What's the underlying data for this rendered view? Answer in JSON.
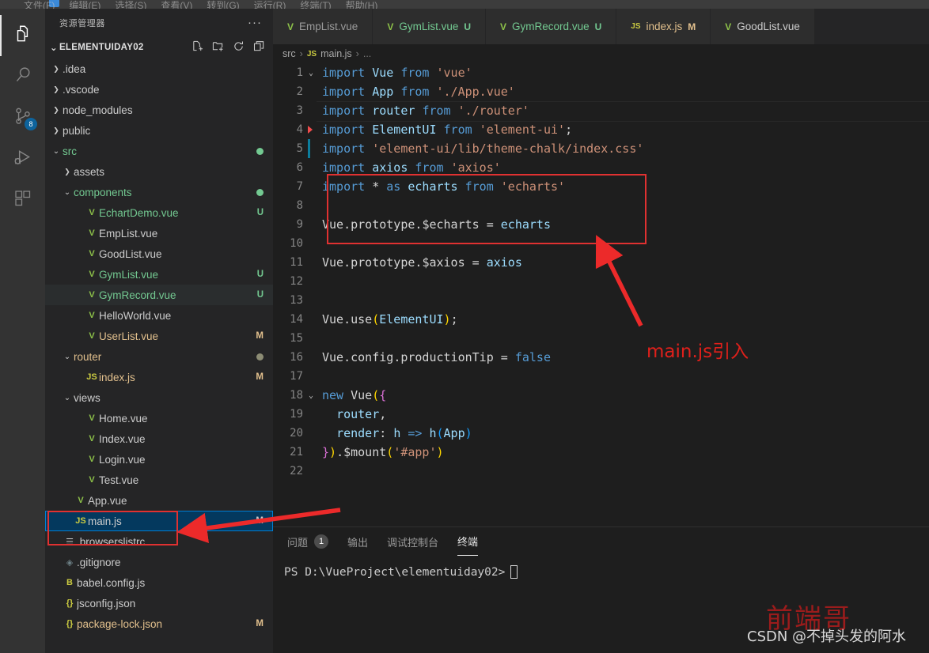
{
  "window": {
    "menu_items": [
      "文件(F)",
      "编辑(E)",
      "选择(S)",
      "查看(V)",
      "转到(G)",
      "运行(R)",
      "终端(T)",
      "帮助(H)"
    ]
  },
  "activity_bar": {
    "items": [
      {
        "name": "explorer",
        "icon": "files-icon",
        "active": true,
        "badge": ""
      },
      {
        "name": "search",
        "icon": "search-icon",
        "active": false,
        "badge": ""
      },
      {
        "name": "source-control",
        "icon": "source-control-icon",
        "active": false,
        "badge": "8"
      },
      {
        "name": "run-debug",
        "icon": "run-debug-icon",
        "active": false,
        "badge": ""
      },
      {
        "name": "extensions",
        "icon": "extensions-icon",
        "active": false,
        "badge": ""
      }
    ]
  },
  "sidebar": {
    "title": "资源管理器",
    "more_actions": "···",
    "root_label": "ELEMENTUIDAY02",
    "root_actions": [
      "new-file-icon",
      "new-folder-icon",
      "refresh-icon",
      "collapse-all-icon"
    ],
    "tree": [
      {
        "label": ".idea",
        "indent": 1,
        "chev": "›",
        "icon": "",
        "icon_cls": "",
        "color": "c-plain",
        "badge": "",
        "dot": "",
        "state": ""
      },
      {
        "label": ".vscode",
        "indent": 1,
        "chev": "›",
        "icon": "",
        "icon_cls": "",
        "color": "c-plain",
        "badge": "",
        "dot": "",
        "state": ""
      },
      {
        "label": "node_modules",
        "indent": 1,
        "chev": "›",
        "icon": "",
        "icon_cls": "",
        "color": "c-plain",
        "badge": "",
        "dot": "",
        "state": ""
      },
      {
        "label": "public",
        "indent": 1,
        "chev": "›",
        "icon": "",
        "icon_cls": "",
        "color": "c-plain",
        "badge": "",
        "dot": "",
        "state": ""
      },
      {
        "label": "src",
        "indent": 1,
        "chev": "⌄",
        "icon": "",
        "icon_cls": "",
        "color": "c-green",
        "badge": "",
        "dot": "d-green",
        "state": ""
      },
      {
        "label": "assets",
        "indent": 2,
        "chev": "›",
        "icon": "",
        "icon_cls": "",
        "color": "c-plain",
        "badge": "",
        "dot": "",
        "state": ""
      },
      {
        "label": "components",
        "indent": 2,
        "chev": "⌄",
        "icon": "",
        "icon_cls": "",
        "color": "c-green",
        "badge": "",
        "dot": "d-green",
        "state": ""
      },
      {
        "label": "EchartDemo.vue",
        "indent": 3,
        "chev": "",
        "icon": "V",
        "icon_cls": "vue-ico",
        "color": "c-green",
        "badge": "U",
        "dot": "",
        "state": ""
      },
      {
        "label": "EmpList.vue",
        "indent": 3,
        "chev": "",
        "icon": "V",
        "icon_cls": "vue-ico",
        "color": "c-plain",
        "badge": "",
        "dot": "",
        "state": ""
      },
      {
        "label": "GoodList.vue",
        "indent": 3,
        "chev": "",
        "icon": "V",
        "icon_cls": "vue-ico",
        "color": "c-plain",
        "badge": "",
        "dot": "",
        "state": ""
      },
      {
        "label": "GymList.vue",
        "indent": 3,
        "chev": "",
        "icon": "V",
        "icon_cls": "vue-ico",
        "color": "c-green",
        "badge": "U",
        "dot": "",
        "state": ""
      },
      {
        "label": "GymRecord.vue",
        "indent": 3,
        "chev": "",
        "icon": "V",
        "icon_cls": "vue-ico",
        "color": "c-green",
        "badge": "U",
        "dot": "",
        "state": "highlight"
      },
      {
        "label": "HelloWorld.vue",
        "indent": 3,
        "chev": "",
        "icon": "V",
        "icon_cls": "vue-ico",
        "color": "c-plain",
        "badge": "",
        "dot": "",
        "state": ""
      },
      {
        "label": "UserList.vue",
        "indent": 3,
        "chev": "",
        "icon": "V",
        "icon_cls": "vue-ico",
        "color": "c-mod",
        "badge": "M",
        "dot": "",
        "state": ""
      },
      {
        "label": "router",
        "indent": 2,
        "chev": "⌄",
        "icon": "",
        "icon_cls": "",
        "color": "c-mod",
        "badge": "",
        "dot": "d-grey",
        "state": ""
      },
      {
        "label": "index.js",
        "indent": 3,
        "chev": "",
        "icon": "JS",
        "icon_cls": "js-ico",
        "color": "c-mod",
        "badge": "M",
        "dot": "",
        "state": ""
      },
      {
        "label": "views",
        "indent": 2,
        "chev": "⌄",
        "icon": "",
        "icon_cls": "",
        "color": "c-plain",
        "badge": "",
        "dot": "",
        "state": ""
      },
      {
        "label": "Home.vue",
        "indent": 3,
        "chev": "",
        "icon": "V",
        "icon_cls": "vue-ico",
        "color": "c-plain",
        "badge": "",
        "dot": "",
        "state": ""
      },
      {
        "label": "Index.vue",
        "indent": 3,
        "chev": "",
        "icon": "V",
        "icon_cls": "vue-ico",
        "color": "c-plain",
        "badge": "",
        "dot": "",
        "state": ""
      },
      {
        "label": "Login.vue",
        "indent": 3,
        "chev": "",
        "icon": "V",
        "icon_cls": "vue-ico",
        "color": "c-plain",
        "badge": "",
        "dot": "",
        "state": ""
      },
      {
        "label": "Test.vue",
        "indent": 3,
        "chev": "",
        "icon": "V",
        "icon_cls": "vue-ico",
        "color": "c-plain",
        "badge": "",
        "dot": "",
        "state": ""
      },
      {
        "label": "App.vue",
        "indent": 2,
        "chev": "",
        "icon": "V",
        "icon_cls": "vue-ico",
        "color": "c-plain",
        "badge": "",
        "dot": "",
        "state": ""
      },
      {
        "label": "main.js",
        "indent": 2,
        "chev": "",
        "icon": "JS",
        "icon_cls": "js-ico",
        "color": "c-plain",
        "badge": "M",
        "dot": "",
        "state": "selected"
      },
      {
        "label": ".browserslistrc",
        "indent": 1,
        "chev": "",
        "icon": "☰",
        "icon_cls": "list-ico",
        "color": "c-plain",
        "badge": "",
        "dot": "",
        "state": ""
      },
      {
        "label": ".gitignore",
        "indent": 1,
        "chev": "",
        "icon": "◈",
        "icon_cls": "git-ico",
        "color": "c-plain",
        "badge": "",
        "dot": "",
        "state": ""
      },
      {
        "label": "babel.config.js",
        "indent": 1,
        "chev": "",
        "icon": "B",
        "icon_cls": "cfg-ico",
        "color": "c-plain",
        "badge": "",
        "dot": "",
        "state": ""
      },
      {
        "label": "jsconfig.json",
        "indent": 1,
        "chev": "",
        "icon": "{}",
        "icon_cls": "json-ico",
        "color": "c-plain",
        "badge": "",
        "dot": "",
        "state": ""
      },
      {
        "label": "package-lock.json",
        "indent": 1,
        "chev": "",
        "icon": "{}",
        "icon_cls": "json-ico",
        "color": "c-mod",
        "badge": "M",
        "dot": "",
        "state": ""
      }
    ]
  },
  "tabs": [
    {
      "label": "EmpList.vue",
      "icon": "V",
      "icon_cls": "vue-ico",
      "badge": "",
      "badge_color": "#73c991",
      "color": "#9a9a9a",
      "active": false
    },
    {
      "label": "GymList.vue",
      "icon": "V",
      "icon_cls": "vue-ico",
      "badge": "U",
      "badge_color": "#73c991",
      "color": "#73c991",
      "active": false
    },
    {
      "label": "GymRecord.vue",
      "icon": "V",
      "icon_cls": "vue-ico",
      "badge": "U",
      "badge_color": "#73c991",
      "color": "#73c991",
      "active": false
    },
    {
      "label": "index.js",
      "icon": "JS",
      "icon_cls": "js-ico",
      "badge": "M",
      "badge_color": "#e2c08d",
      "color": "#e2c08d",
      "active": false
    },
    {
      "label": "GoodList.vue",
      "icon": "V",
      "icon_cls": "vue-ico",
      "badge": "",
      "badge_color": "#9a9a9a",
      "color": "#cccccc",
      "active": false
    }
  ],
  "breadcrumb": {
    "root": "src",
    "file": "main.js",
    "file_icon": "JS",
    "tail": "..."
  },
  "code": {
    "lines": [
      {
        "n": "1",
        "fold": "⌄",
        "marker": "",
        "cur": false,
        "tokens": [
          {
            "t": "import",
            "c": "k"
          },
          {
            "t": " ",
            "c": "w"
          },
          {
            "t": "Vue",
            "c": "v"
          },
          {
            "t": " ",
            "c": "w"
          },
          {
            "t": "from",
            "c": "k"
          },
          {
            "t": " ",
            "c": "w"
          },
          {
            "t": "'vue'",
            "c": "s"
          }
        ]
      },
      {
        "n": "2",
        "fold": "",
        "marker": "",
        "cur": false,
        "tokens": [
          {
            "t": "import",
            "c": "k"
          },
          {
            "t": " ",
            "c": "w"
          },
          {
            "t": "App",
            "c": "v"
          },
          {
            "t": " ",
            "c": "w"
          },
          {
            "t": "from",
            "c": "k"
          },
          {
            "t": " ",
            "c": "w"
          },
          {
            "t": "'./App.vue'",
            "c": "s"
          }
        ]
      },
      {
        "n": "3",
        "fold": "",
        "marker": "",
        "cur": true,
        "tokens": [
          {
            "t": "import",
            "c": "k"
          },
          {
            "t": " ",
            "c": "w"
          },
          {
            "t": "router",
            "c": "v"
          },
          {
            "t": " ",
            "c": "w"
          },
          {
            "t": "from",
            "c": "k"
          },
          {
            "t": " ",
            "c": "w"
          },
          {
            "t": "'./router'",
            "c": "s"
          }
        ]
      },
      {
        "n": "4",
        "fold": "",
        "marker": "err",
        "cur": false,
        "tokens": [
          {
            "t": "import",
            "c": "k"
          },
          {
            "t": " ",
            "c": "w"
          },
          {
            "t": "ElementUI",
            "c": "v"
          },
          {
            "t": " ",
            "c": "w"
          },
          {
            "t": "from",
            "c": "k"
          },
          {
            "t": " ",
            "c": "w"
          },
          {
            "t": "'element-ui'",
            "c": "s"
          },
          {
            "t": ";",
            "c": "w"
          }
        ]
      },
      {
        "n": "5",
        "fold": "",
        "marker": "mod",
        "cur": false,
        "tokens": [
          {
            "t": "import",
            "c": "k"
          },
          {
            "t": " ",
            "c": "w"
          },
          {
            "t": "'element-ui/lib/theme-chalk/index.css'",
            "c": "s"
          }
        ]
      },
      {
        "n": "6",
        "fold": "",
        "marker": "",
        "cur": false,
        "tokens": [
          {
            "t": "import",
            "c": "k"
          },
          {
            "t": " ",
            "c": "w"
          },
          {
            "t": "axios",
            "c": "v"
          },
          {
            "t": " ",
            "c": "w"
          },
          {
            "t": "from",
            "c": "k"
          },
          {
            "t": " ",
            "c": "w"
          },
          {
            "t": "'axios'",
            "c": "s"
          }
        ]
      },
      {
        "n": "7",
        "fold": "",
        "marker": "",
        "cur": false,
        "tokens": [
          {
            "t": "import",
            "c": "k"
          },
          {
            "t": " ",
            "c": "w"
          },
          {
            "t": "*",
            "c": "w"
          },
          {
            "t": " ",
            "c": "w"
          },
          {
            "t": "as",
            "c": "k"
          },
          {
            "t": " ",
            "c": "w"
          },
          {
            "t": "echarts",
            "c": "v"
          },
          {
            "t": " ",
            "c": "w"
          },
          {
            "t": "from",
            "c": "k"
          },
          {
            "t": " ",
            "c": "w"
          },
          {
            "t": "'echarts'",
            "c": "s"
          }
        ]
      },
      {
        "n": "8",
        "fold": "",
        "marker": "",
        "cur": false,
        "tokens": []
      },
      {
        "n": "9",
        "fold": "",
        "marker": "",
        "cur": false,
        "tokens": [
          {
            "t": "Vue",
            "c": "w"
          },
          {
            "t": ".",
            "c": "w"
          },
          {
            "t": "prototype",
            "c": "w"
          },
          {
            "t": ".",
            "c": "w"
          },
          {
            "t": "$echarts",
            "c": "w"
          },
          {
            "t": " = ",
            "c": "w"
          },
          {
            "t": "echarts",
            "c": "v"
          }
        ]
      },
      {
        "n": "10",
        "fold": "",
        "marker": "",
        "cur": false,
        "tokens": []
      },
      {
        "n": "11",
        "fold": "",
        "marker": "",
        "cur": false,
        "tokens": [
          {
            "t": "Vue",
            "c": "w"
          },
          {
            "t": ".",
            "c": "w"
          },
          {
            "t": "prototype",
            "c": "w"
          },
          {
            "t": ".",
            "c": "w"
          },
          {
            "t": "$axios",
            "c": "w"
          },
          {
            "t": " = ",
            "c": "w"
          },
          {
            "t": "axios",
            "c": "v"
          }
        ]
      },
      {
        "n": "12",
        "fold": "",
        "marker": "",
        "cur": false,
        "tokens": []
      },
      {
        "n": "13",
        "fold": "",
        "marker": "",
        "cur": false,
        "tokens": []
      },
      {
        "n": "14",
        "fold": "",
        "marker": "",
        "cur": false,
        "tokens": [
          {
            "t": "Vue",
            "c": "w"
          },
          {
            "t": ".",
            "c": "w"
          },
          {
            "t": "use",
            "c": "w"
          },
          {
            "t": "(",
            "c": "b1"
          },
          {
            "t": "ElementUI",
            "c": "v"
          },
          {
            "t": ")",
            "c": "b1"
          },
          {
            "t": ";",
            "c": "w"
          }
        ]
      },
      {
        "n": "15",
        "fold": "",
        "marker": "",
        "cur": false,
        "tokens": []
      },
      {
        "n": "16",
        "fold": "",
        "marker": "",
        "cur": false,
        "tokens": [
          {
            "t": "Vue",
            "c": "w"
          },
          {
            "t": ".",
            "c": "w"
          },
          {
            "t": "config",
            "c": "w"
          },
          {
            "t": ".",
            "c": "w"
          },
          {
            "t": "productionTip",
            "c": "w"
          },
          {
            "t": " = ",
            "c": "w"
          },
          {
            "t": "false",
            "c": "k"
          }
        ]
      },
      {
        "n": "17",
        "fold": "",
        "marker": "",
        "cur": false,
        "tokens": []
      },
      {
        "n": "18",
        "fold": "⌄",
        "marker": "",
        "cur": false,
        "tokens": [
          {
            "t": "new",
            "c": "k"
          },
          {
            "t": " ",
            "c": "w"
          },
          {
            "t": "Vue",
            "c": "w"
          },
          {
            "t": "(",
            "c": "b1"
          },
          {
            "t": "{",
            "c": "b2"
          }
        ]
      },
      {
        "n": "19",
        "fold": "",
        "marker": "",
        "cur": false,
        "tokens": [
          {
            "t": "  ",
            "c": "w"
          },
          {
            "t": "router",
            "c": "v"
          },
          {
            "t": ",",
            "c": "w"
          }
        ]
      },
      {
        "n": "20",
        "fold": "",
        "marker": "",
        "cur": false,
        "tokens": [
          {
            "t": "  ",
            "c": "w"
          },
          {
            "t": "render",
            "c": "v"
          },
          {
            "t": ": ",
            "c": "w"
          },
          {
            "t": "h",
            "c": "v"
          },
          {
            "t": " ",
            "c": "w"
          },
          {
            "t": "=>",
            "c": "k"
          },
          {
            "t": " ",
            "c": "w"
          },
          {
            "t": "h",
            "c": "v"
          },
          {
            "t": "(",
            "c": "b3"
          },
          {
            "t": "App",
            "c": "v"
          },
          {
            "t": ")",
            "c": "b3"
          }
        ]
      },
      {
        "n": "21",
        "fold": "",
        "marker": "",
        "cur": false,
        "tokens": [
          {
            "t": "}",
            "c": "b2"
          },
          {
            "t": ")",
            "c": "b1"
          },
          {
            "t": ".",
            "c": "w"
          },
          {
            "t": "$mount",
            "c": "w"
          },
          {
            "t": "(",
            "c": "b1"
          },
          {
            "t": "'#app'",
            "c": "s"
          },
          {
            "t": ")",
            "c": "b1"
          }
        ]
      },
      {
        "n": "22",
        "fold": "",
        "marker": "",
        "cur": false,
        "tokens": []
      }
    ]
  },
  "panel": {
    "tabs": [
      {
        "label": "问题",
        "badge": "1",
        "active": false
      },
      {
        "label": "输出",
        "badge": "",
        "active": false
      },
      {
        "label": "调试控制台",
        "badge": "",
        "active": false
      },
      {
        "label": "终端",
        "badge": "",
        "active": true
      }
    ],
    "terminal_prompt": "PS D:\\VueProject\\elementuiday02>"
  },
  "annotations": {
    "code_note": "main.js引入",
    "accent_color": "#e03131"
  },
  "watermark": {
    "red": "前端哥",
    "white": "CSDN @不掉头发的阿水"
  }
}
